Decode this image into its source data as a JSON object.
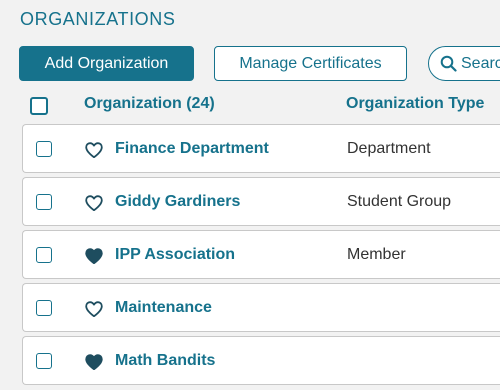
{
  "page_title": "ORGANIZATIONS",
  "toolbar": {
    "add_label": "Add Organization",
    "manage_label": "Manage Certificates",
    "search_placeholder": "Search"
  },
  "table": {
    "columns": {
      "organization": "Organization (24)",
      "type": "Organization Type"
    },
    "rows": [
      {
        "name": "Finance Department",
        "type": "Department",
        "favorited": false
      },
      {
        "name": "Giddy Gardiners",
        "type": "Student Group",
        "favorited": false
      },
      {
        "name": "IPP Association",
        "type": "Member",
        "favorited": true
      },
      {
        "name": "Maintenance",
        "type": "",
        "favorited": false
      },
      {
        "name": "Math Bandits",
        "type": "",
        "favorited": true
      }
    ]
  },
  "colors": {
    "accent": "#16728c",
    "heart": "#1e4d5f"
  },
  "icons": {
    "search": "search-icon",
    "favorite_empty": "heart-outline-icon",
    "favorite_filled": "heart-filled-icon"
  }
}
